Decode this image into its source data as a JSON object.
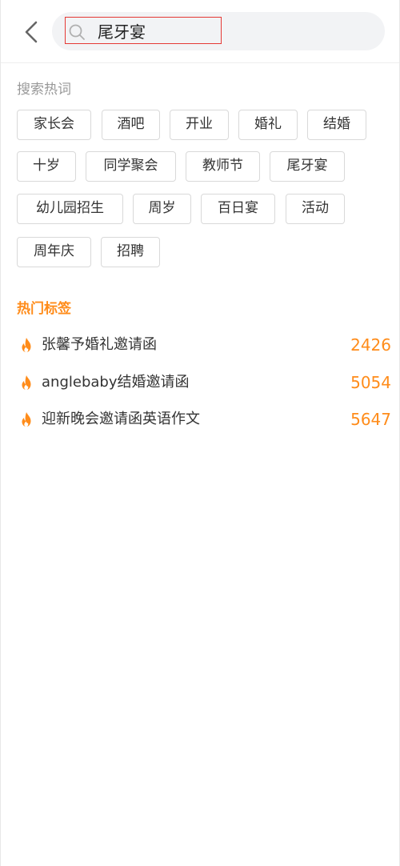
{
  "search": {
    "value": "尾牙宴"
  },
  "hot_words": {
    "title": "搜索热词",
    "items": [
      "家长会",
      "酒吧",
      "开业",
      "婚礼",
      "结婚",
      "十岁",
      "同学聚会",
      "教师节",
      "尾牙宴",
      "幼儿园招生",
      "周岁",
      "百日宴",
      "活动",
      "周年庆",
      "招聘"
    ]
  },
  "hot_tags": {
    "title": "热门标签",
    "items": [
      {
        "label": "张馨予婚礼邀请函",
        "count": "2426"
      },
      {
        "label": "anglebaby结婚邀请函",
        "count": "5054"
      },
      {
        "label": "迎新晚会邀请函英语作文",
        "count": "5647"
      }
    ]
  },
  "colors": {
    "accent": "#ff8c1a",
    "highlight_border": "#e53935",
    "chip_border": "#d9d9d9",
    "muted_text": "#999999",
    "search_bg": "#f2f3f5"
  },
  "icons": {
    "back": "chevron-left-icon",
    "search": "search-icon",
    "tag": "fire-icon"
  }
}
